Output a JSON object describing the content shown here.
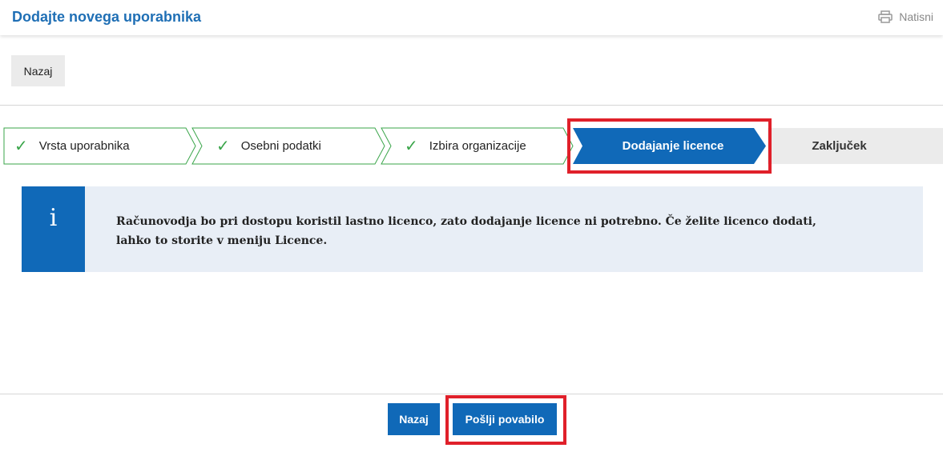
{
  "header": {
    "title": "Dodajte novega uporabnika",
    "print_label": "Natisni"
  },
  "top_back_label": "Nazaj",
  "wizard": {
    "steps": [
      {
        "label": "Vrsta uporabnika",
        "status": "done"
      },
      {
        "label": "Osebni podatki",
        "status": "done"
      },
      {
        "label": "Izbira organizacije",
        "status": "done"
      },
      {
        "label": "Dodajanje licence",
        "status": "active"
      },
      {
        "label": "Zaključek",
        "status": "pending"
      }
    ],
    "check_glyph": "✓"
  },
  "info": {
    "icon": "i",
    "text": "Računovodja bo pri dostopu koristil lastno licenco, zato dodajanje licence ni potrebno. Če želite licenco dodati, lahko to storite v meniju Licence."
  },
  "footer": {
    "back_label": "Nazaj",
    "send_label": "Pošlji povabilo"
  },
  "colors": {
    "primary": "#1069b8",
    "title": "#1f6fb5",
    "success": "#3aa54a",
    "highlight": "#e0202a",
    "info_bg": "#e8eef6"
  }
}
